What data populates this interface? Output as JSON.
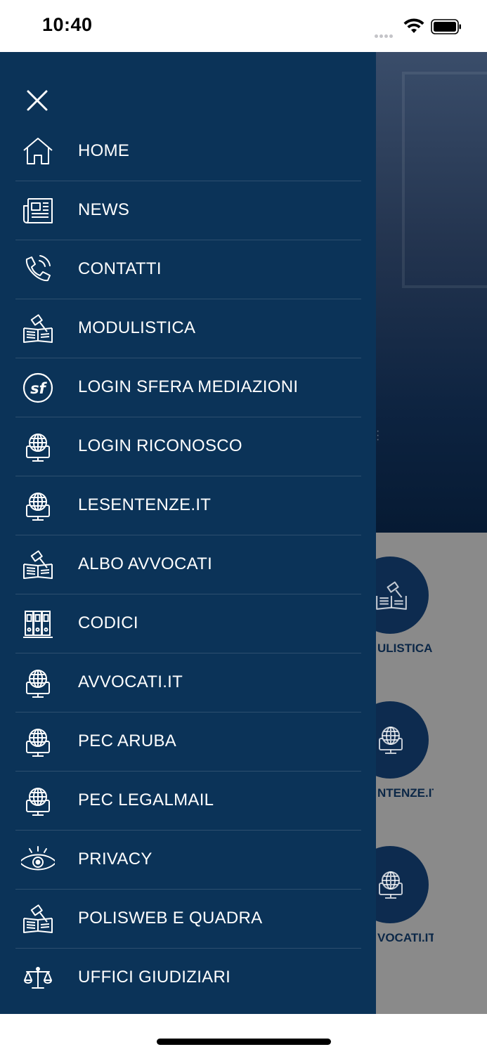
{
  "status_bar": {
    "time": "10:40"
  },
  "drawer": {
    "background": "#0b3358",
    "items": [
      {
        "label": "HOME",
        "icon": "home-icon"
      },
      {
        "label": "NEWS",
        "icon": "newspaper-icon"
      },
      {
        "label": "CONTATTI",
        "icon": "phone-icon"
      },
      {
        "label": "MODULISTICA",
        "icon": "gavel-book-icon"
      },
      {
        "label": "LOGIN SFERA MEDIAZIONI",
        "icon": "sf-logo-icon"
      },
      {
        "label": "LOGIN RICONOSCO",
        "icon": "globe-monitor-icon"
      },
      {
        "label": "LESENTENZE.IT",
        "icon": "globe-monitor-icon"
      },
      {
        "label": "ALBO AVVOCATI",
        "icon": "gavel-book-icon"
      },
      {
        "label": "CODICI",
        "icon": "binders-icon"
      },
      {
        "label": "AVVOCATI.IT",
        "icon": "globe-monitor-icon"
      },
      {
        "label": "PEC ARUBA",
        "icon": "globe-monitor-icon"
      },
      {
        "label": "PEC LEGALMAIL",
        "icon": "globe-monitor-icon"
      },
      {
        "label": "PRIVACY",
        "icon": "eye-icon"
      },
      {
        "label": "POLISWEB E QUADRA",
        "icon": "gavel-book-icon"
      },
      {
        "label": "UFFICI GIUDIZIARI",
        "icon": "scales-icon"
      }
    ]
  },
  "background_tiles": [
    {
      "label": "ULISTICA",
      "icon": "gavel-book-icon"
    },
    {
      "label": "NTENZE.IT",
      "icon": "globe-monitor-icon"
    },
    {
      "label": "VOCATI.IT",
      "icon": "globe-monitor-icon"
    }
  ]
}
